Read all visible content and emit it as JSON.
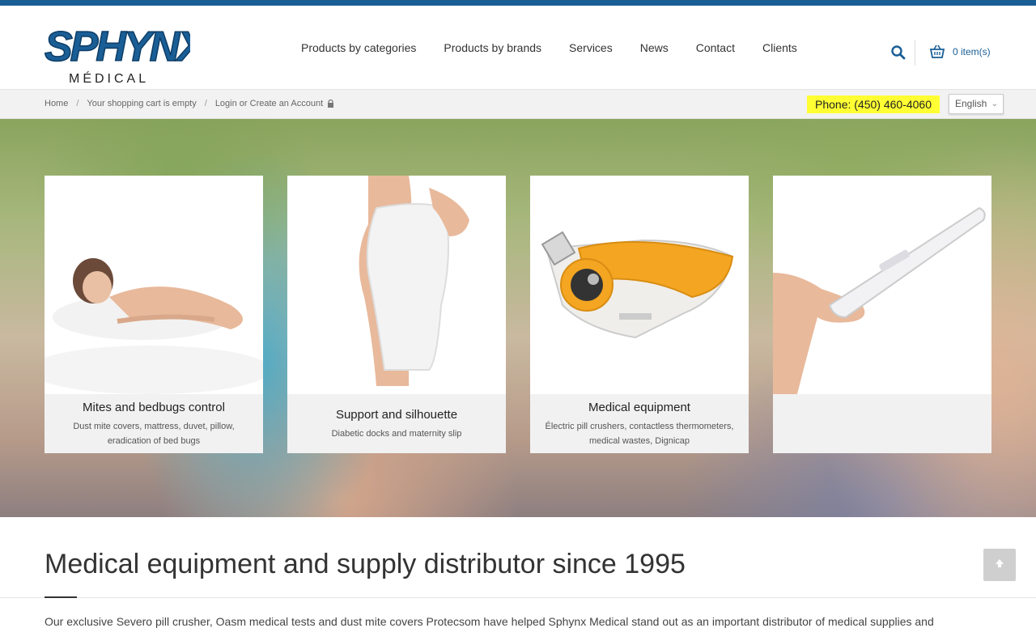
{
  "brand": {
    "logo_text": "SPHYNX",
    "logo_subtext": "MÉDICAL",
    "color": "#1a5e96"
  },
  "nav": {
    "items": [
      {
        "label": "Products by categories"
      },
      {
        "label": "Products by brands"
      },
      {
        "label": "Services"
      },
      {
        "label": "News"
      },
      {
        "label": "Contact"
      },
      {
        "label": "Clients"
      }
    ]
  },
  "header": {
    "search_icon": "search-icon",
    "cart_icon": "basket-icon",
    "cart_label": "0 item(s)"
  },
  "breadcrumb": {
    "home": "Home",
    "cart": "Your shopping cart is empty",
    "login": "Login or Create an Account",
    "separator": "/"
  },
  "phone": {
    "label": "Phone: (450) 460-4060",
    "highlight": "#ffff33"
  },
  "language": {
    "selected": "English"
  },
  "cards": [
    {
      "title": "Mites and bedbugs control",
      "description": "Dust mite covers, mattress, duvet, pillow, eradication of bed bugs"
    },
    {
      "title": "Support and silhouette",
      "description": "Diabetic docks and maternity slip"
    },
    {
      "title": "Medical equipment",
      "description": "Électric pill crushers, contactless thermometers, medical wastes, Dignicap"
    },
    {
      "title": "",
      "description": ""
    }
  ],
  "main": {
    "title": "Medical equipment and supply distributor since 1995",
    "intro": "Our exclusive Severo pill crusher, Oasm medical tests and dust mite covers Protecsom have helped Sphynx Medical stand out as an important distributor of medical supplies and"
  }
}
